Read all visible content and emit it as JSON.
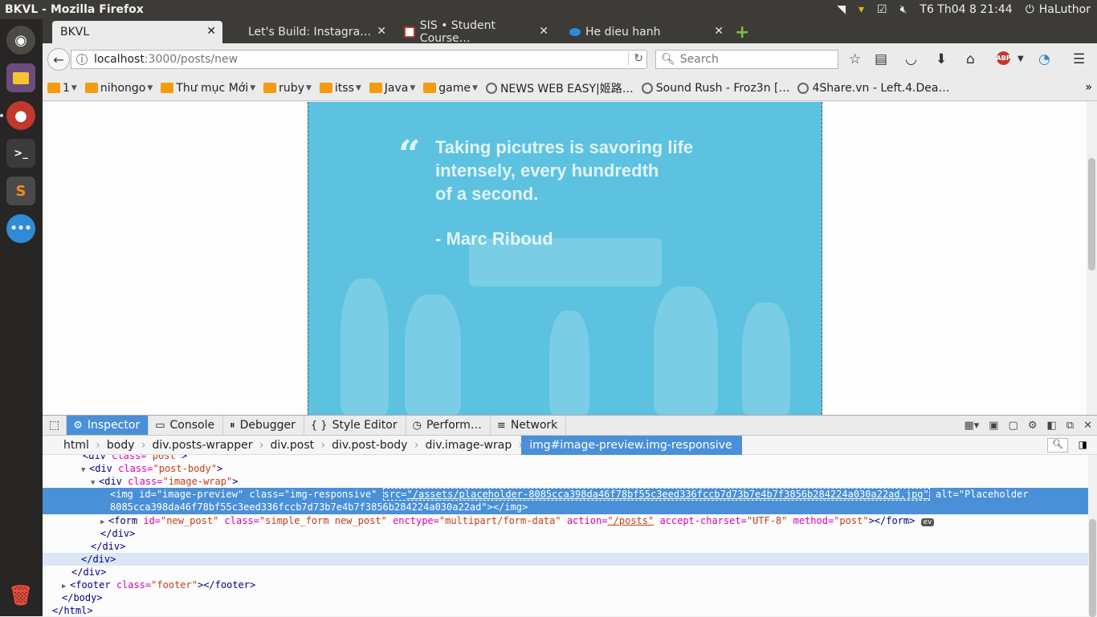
{
  "window_title": "BKVL - Mozilla Firefox",
  "panel": {
    "clock": "T6 Th04  8 21:44",
    "user": "HaLuthor"
  },
  "tabs": [
    {
      "label": "BKVL",
      "active": true
    },
    {
      "label": "Let's Build: Instagra…",
      "active": false
    },
    {
      "label": "SIS • Student Course…",
      "active": false
    },
    {
      "label": "He dieu hanh",
      "active": false
    }
  ],
  "url": {
    "host": "localhost",
    "rest": ":3000/posts/new"
  },
  "search": {
    "placeholder": "Search"
  },
  "bookmarks": [
    {
      "label": "1",
      "type": "folder"
    },
    {
      "label": "nihongo",
      "type": "folder"
    },
    {
      "label": "Thư mục Mới",
      "type": "folder"
    },
    {
      "label": "ruby",
      "type": "folder"
    },
    {
      "label": "itss",
      "type": "folder"
    },
    {
      "label": "Java",
      "type": "folder"
    },
    {
      "label": "game",
      "type": "folder"
    },
    {
      "label": "NEWS WEB EASY|姬路…",
      "type": "link"
    },
    {
      "label": "Sound Rush - Froz3n […",
      "type": "link"
    },
    {
      "label": "4Share.vn - Left.4.Dea…",
      "type": "link"
    }
  ],
  "image": {
    "quote_mark": "“",
    "quote_lines": [
      "Taking picutres is savoring life",
      "intensely, every hundredth",
      "of a second."
    ],
    "author": "- Marc Riboud"
  },
  "devtools": {
    "tabs": [
      "Inspector",
      "Console",
      "Debugger",
      "Style Editor",
      "Perform…",
      "Network"
    ],
    "breadcrumbs": [
      "html",
      "body",
      "div.posts-wrapper",
      "div.post",
      "div.post-body",
      "div.image-wrap",
      "img#image-preview.img-responsive"
    ],
    "markup": {
      "l1_tag": "<div",
      "l1_attr": "class=",
      "l1_val": "\"post-body\"",
      "l2_val": "\"image-wrap\"",
      "img_id": "\"image-preview\"",
      "img_class": "\"img-responsive\"",
      "img_src": "\"/assets/placeholder-8085cca398da46f78bf55c3eed336fccb7d73b7e4b7f3856b284224a030a22ad.jpg\"",
      "img_alt_1": "\"Placeholder",
      "img_alt_2": "8085cca398da46f78bf55c3eed336fccb7d73b7e4b7f3856b284224a030a22ad\"",
      "form_id": "\"new_post\"",
      "form_class": "\"simple_form new_post\"",
      "form_enctype": "\"multipart/form-data\"",
      "form_action": "\"/posts\"",
      "form_charset": "\"UTF-8\"",
      "form_method": "\"post\"",
      "footer_class": "\"footer\"",
      "ev": "ev"
    }
  }
}
